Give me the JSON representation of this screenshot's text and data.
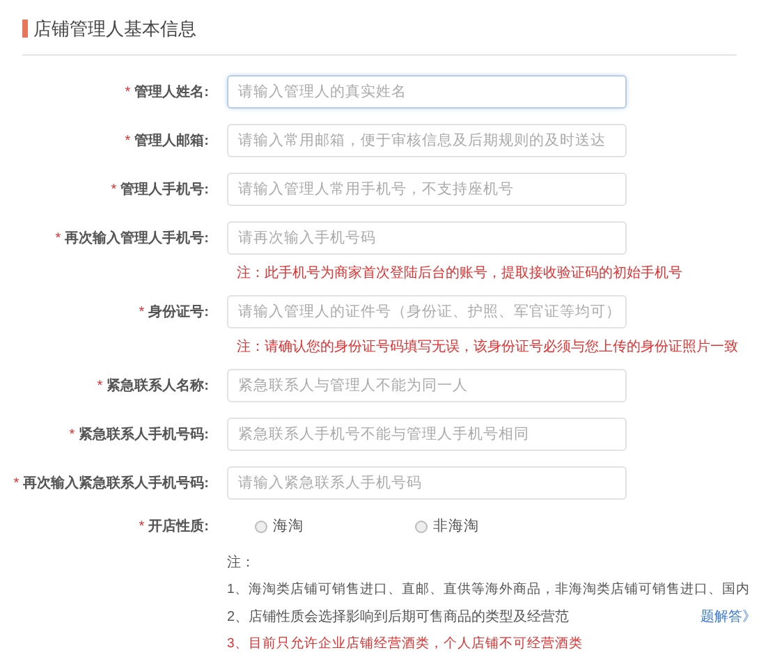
{
  "section_title": "店铺管理人基本信息",
  "rows": [
    {
      "kind": "field",
      "required_mark": "*",
      "label": "管理人姓名:",
      "placeholder": "请输入管理人的真实姓名",
      "focused": true
    },
    {
      "kind": "field",
      "required_mark": "*",
      "label": "管理人邮箱:",
      "placeholder": "请输入常用邮箱，便于审核信息及后期规则的及时送达",
      "focused": false
    },
    {
      "kind": "field",
      "required_mark": "*",
      "label": "管理人手机号:",
      "placeholder": "请输入管理人常用手机号，不支持座机号",
      "focused": false
    },
    {
      "kind": "field",
      "required_mark": "*",
      "label": "再次输入管理人手机号:",
      "placeholder": "请再次输入手机号码",
      "focused": false
    },
    {
      "kind": "note",
      "text": "注：此手机号为商家首次登陆后台的账号，提取接收验证码的初始手机号"
    },
    {
      "kind": "field",
      "required_mark": "*",
      "label": "身份证号:",
      "placeholder": "请输入管理人的证件号（身份证、护照、军官证等均可）",
      "focused": false
    },
    {
      "kind": "note",
      "text": "注：请确认您的身份证号码填写无误，该身份证号必须与您上传的身份证照片一致"
    },
    {
      "kind": "field",
      "required_mark": "*",
      "label": "紧急联系人名称:",
      "placeholder": "紧急联系人与管理人不能为同一人",
      "focused": false
    },
    {
      "kind": "field",
      "required_mark": "*",
      "label": "紧急联系人手机号码:",
      "placeholder": "紧急联系人手机号不能与管理人手机号相同",
      "focused": false
    },
    {
      "kind": "field",
      "required_mark": "*",
      "label": "再次输入紧急联系人手机号码:",
      "placeholder": "请输入紧急联系人手机号码",
      "focused": false
    },
    {
      "kind": "radio",
      "required_mark": "*",
      "label": "开店性质:",
      "options": [
        {
          "label": "海淘",
          "selected": false
        },
        {
          "label": "非海淘",
          "selected": false
        }
      ]
    }
  ],
  "notes": {
    "heading": "注：",
    "lines": [
      {
        "kind": "plain",
        "text": "1、海淘类店铺可销售进口、直邮、直供等海外商品，非海淘类店铺可销售进口、国内"
      },
      {
        "kind": "plain_link",
        "text": "2、店铺性质会选择影响到后期可售商品的类型及经营范",
        "link": "题解答》"
      },
      {
        "kind": "warning",
        "text": "3、目前只允许企业店铺经营酒类，个人店铺不可经营酒类"
      }
    ]
  }
}
